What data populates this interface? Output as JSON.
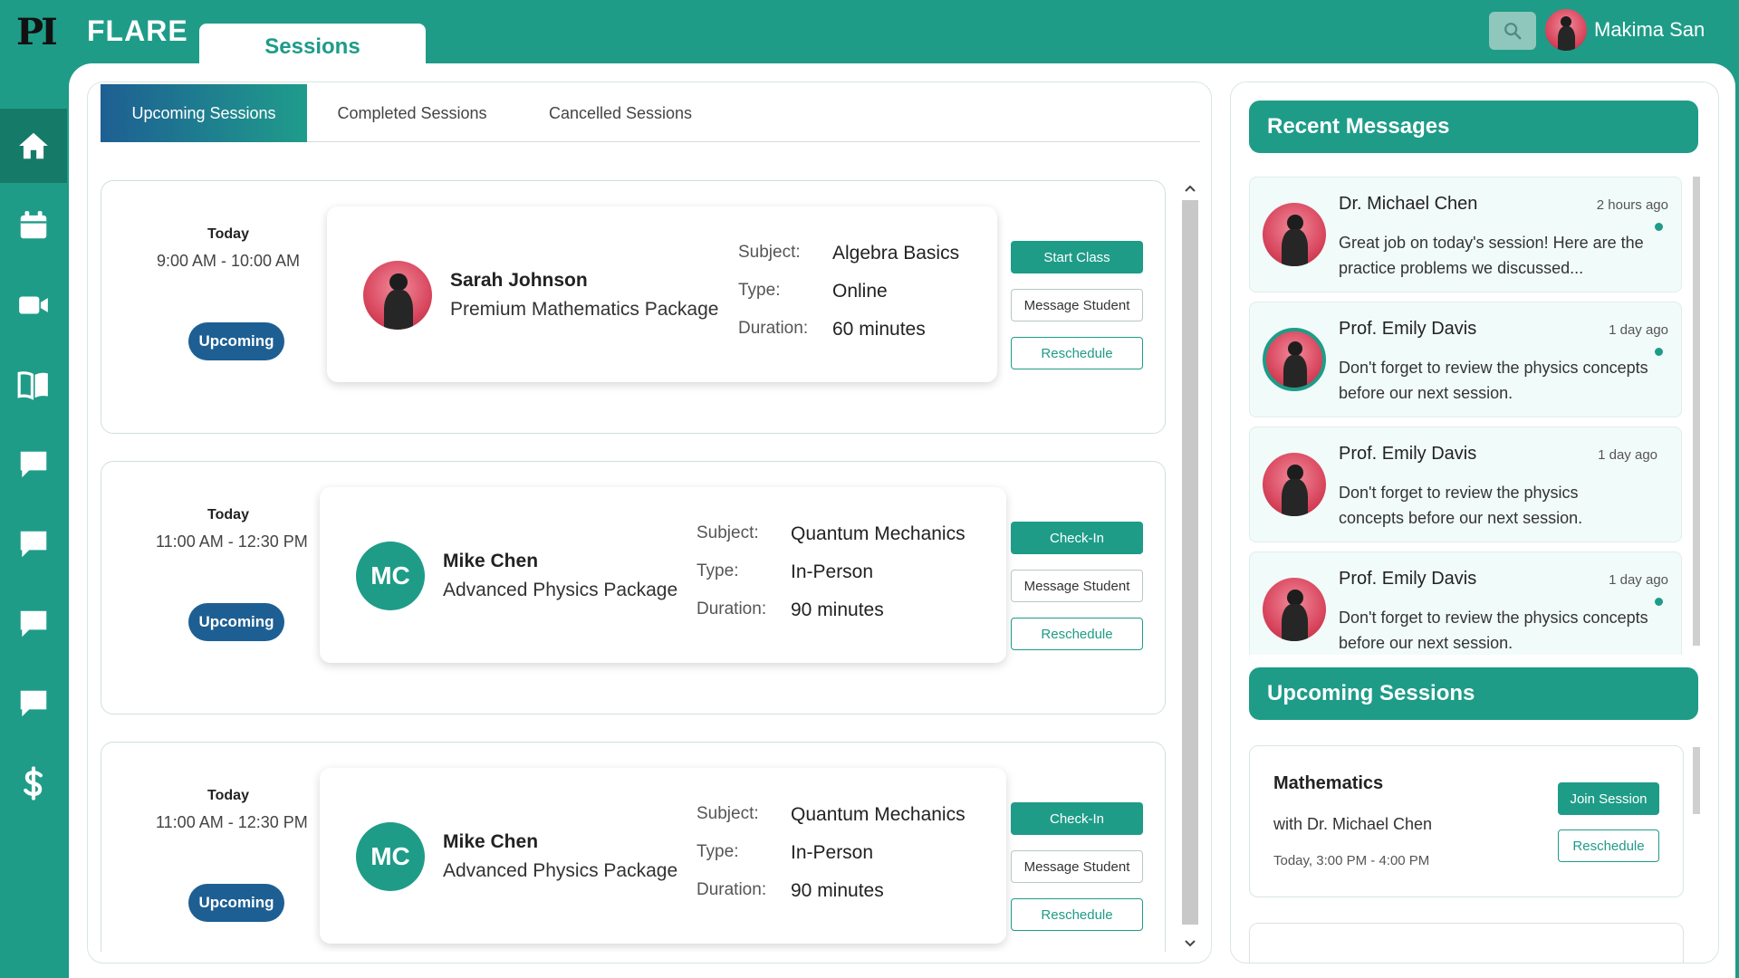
{
  "app": {
    "logo": "PI",
    "brand": "FLARE"
  },
  "header": {
    "active_tab": "Sessions",
    "user_name": "Makima San"
  },
  "colors": {
    "accent": "#1e9c88",
    "badge": "#1e5f93"
  },
  "sidebar": {
    "items": [
      {
        "icon": "home-icon",
        "active": true
      },
      {
        "icon": "calendar-icon"
      },
      {
        "icon": "video-camera-icon"
      },
      {
        "icon": "book-icon"
      },
      {
        "icon": "chat-icon"
      },
      {
        "icon": "chat-icon"
      },
      {
        "icon": "chat-icon"
      },
      {
        "icon": "chat-icon"
      },
      {
        "icon": "dollar-icon"
      }
    ]
  },
  "tabs": [
    "Upcoming Sessions",
    "Completed Sessions",
    "Cancelled Sessions"
  ],
  "labels": {
    "subject": "Subject:",
    "type": "Type:",
    "duration": "Duration:"
  },
  "sessions": [
    {
      "day": "Today",
      "time": "9:00 AM - 10:00 AM",
      "status": "Upcoming",
      "name": "Sarah Johnson",
      "package": "Premium Mathematics Package",
      "avatar": "photo",
      "subject": "Algebra Basics",
      "type": "Online",
      "duration": "60 minutes",
      "actions": [
        "Start Class",
        "Message Student",
        "Reschedule"
      ]
    },
    {
      "day": "Today",
      "time": "11:00 AM - 12:30 PM",
      "status": "Upcoming",
      "name": "Mike Chen",
      "package": "Advanced Physics Package",
      "initials": "MC",
      "subject": "Quantum Mechanics",
      "type": "In-Person",
      "duration": "90 minutes",
      "actions": [
        "Check-In",
        "Message Student",
        "Reschedule"
      ]
    },
    {
      "day": "Today",
      "time": "11:00 AM - 12:30 PM",
      "status": "Upcoming",
      "name": "Mike Chen",
      "package": "Advanced Physics Package",
      "initials": "MC",
      "subject": "Quantum Mechanics",
      "type": "In-Person",
      "duration": "90 minutes",
      "actions": [
        "Check-In",
        "Message Student",
        "Reschedule"
      ]
    }
  ],
  "recent_messages": {
    "title": "Recent Messages",
    "items": [
      {
        "name": "Dr. Michael Chen",
        "ago": "2 hours ago",
        "text": "Great job on today's session! Here are the practice problems we discussed...",
        "unread": true
      },
      {
        "name": "Prof. Emily Davis",
        "ago": "1 day ago",
        "text": "Don't forget to review the physics concepts before our next session.",
        "unread": true
      },
      {
        "name": "Prof. Emily Davis",
        "ago": "1 day ago",
        "text": "Don't forget to review the physics concepts before our next session.",
        "unread": false
      },
      {
        "name": "Prof. Emily Davis",
        "ago": "1 day ago",
        "text": "Don't forget to review the physics concepts before our next session.",
        "unread": true
      }
    ]
  },
  "upcoming": {
    "title": "Upcoming Sessions",
    "items": [
      {
        "subject": "Mathematics",
        "with": "with Dr. Michael Chen",
        "when": "Today, 3:00 PM - 4:00 PM",
        "join_label": "Join Session",
        "reschedule_label": "Reschedule"
      }
    ]
  }
}
